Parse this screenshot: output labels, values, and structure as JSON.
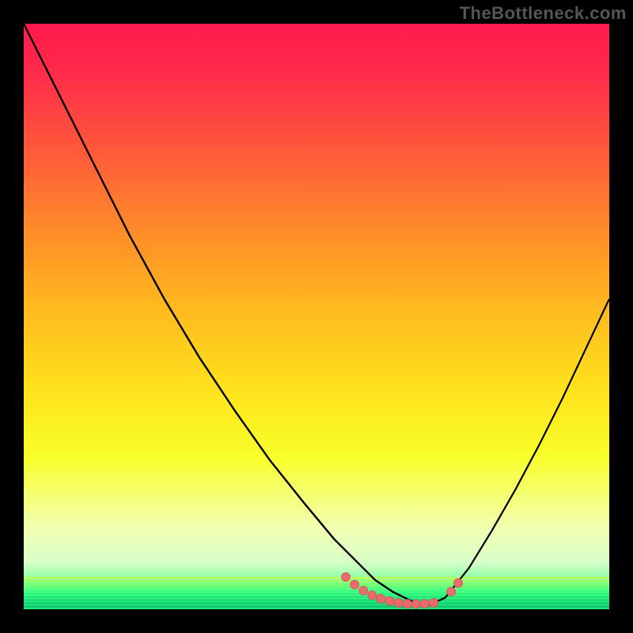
{
  "watermark": "TheBottleneck.com",
  "colors": {
    "page_bg": "#000000",
    "watermark_text": "#555555",
    "curve_stroke": "#000000",
    "marker_fill": "#e86c6c",
    "marker_stroke": "#d85a5a"
  },
  "chart_data": {
    "type": "line",
    "title": "",
    "xlabel": "",
    "ylabel": "",
    "xlim": [
      0,
      100
    ],
    "ylim": [
      0,
      100
    ],
    "background": {
      "style": "vertical-gradient",
      "top_color": "#ff1a4d",
      "mid_color": "#ffe11c",
      "bottom_color": "#18e676",
      "bottom_stripes": true
    },
    "series": [
      {
        "name": "left-descending-curve",
        "x": [
          0,
          6,
          12,
          18,
          24,
          30,
          36,
          42,
          48,
          53,
          56,
          58,
          60,
          63,
          66,
          69
        ],
        "y": [
          100,
          88,
          76,
          64,
          53,
          43,
          34,
          25.5,
          18,
          12,
          9,
          7,
          5,
          3,
          1.5,
          0.6
        ]
      },
      {
        "name": "right-ascending-curve",
        "x": [
          69,
          72,
          76,
          80,
          84,
          88,
          92,
          96,
          100
        ],
        "y": [
          0.6,
          2,
          7,
          13.5,
          20.5,
          28,
          36,
          44.5,
          53
        ]
      }
    ],
    "markers": {
      "name": "highlight-region",
      "description": "cluster of rounded markers hugging the trough near the bottom",
      "points": [
        {
          "x": 55,
          "y": 5.5
        },
        {
          "x": 56.5,
          "y": 4.2
        },
        {
          "x": 58,
          "y": 3.2
        },
        {
          "x": 59.5,
          "y": 2.4
        },
        {
          "x": 61,
          "y": 1.8
        },
        {
          "x": 62.5,
          "y": 1.4
        },
        {
          "x": 64,
          "y": 1.1
        },
        {
          "x": 65.5,
          "y": 0.95
        },
        {
          "x": 67,
          "y": 0.9
        },
        {
          "x": 68.5,
          "y": 0.95
        },
        {
          "x": 70,
          "y": 1.1
        },
        {
          "x": 73,
          "y": 3.0
        },
        {
          "x": 74.2,
          "y": 4.5
        }
      ],
      "radius": 5.5
    }
  }
}
